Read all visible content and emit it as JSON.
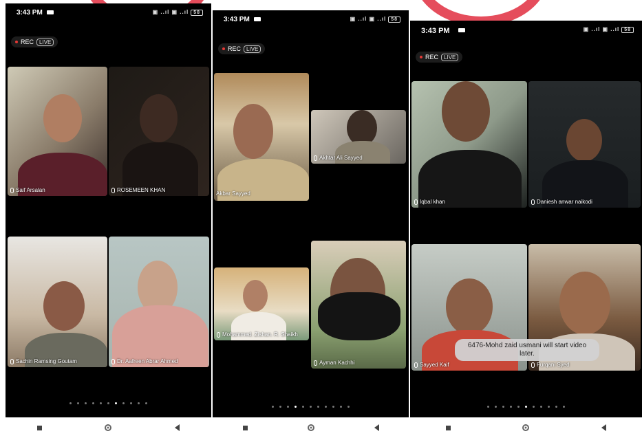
{
  "phones": [
    {
      "time": "3:43 PM",
      "status_icons": "▣ ..ıl ▣ ..ıl",
      "battery": "58",
      "rec": "REC",
      "live": "LIVE",
      "participants": [
        "Saif Arsalan",
        "ROSEMEEN KHAN",
        "Sachin Ramsing Goutam",
        "Dr. Aafreen Abrar Ahmed"
      ]
    },
    {
      "time": "3:43 PM",
      "status_icons": "▣ ..ıl ▣ ..ıl",
      "battery": "58",
      "rec": "REC",
      "live": "LIVE",
      "participants": [
        "Akbar Sayyed",
        "Akhtar Ali Sayyed",
        "Mohammed. Zishan. R. Shaikh",
        "Ayman Kachhi"
      ]
    },
    {
      "time": "3:43 PM",
      "status_icons": "▣ ..ıl ▣ ..ıl",
      "battery": "58",
      "rec": "REC",
      "live": "LIVE",
      "participants": [
        "Iqbal khan",
        "Daniesh anwar naikodi",
        "Sayyed Kaif",
        "Furqani Syed"
      ],
      "toast": "6476-Mohd zaid usmani will start video later."
    }
  ],
  "colors": {
    "accent": "#e23a4a",
    "background": "#000000"
  }
}
